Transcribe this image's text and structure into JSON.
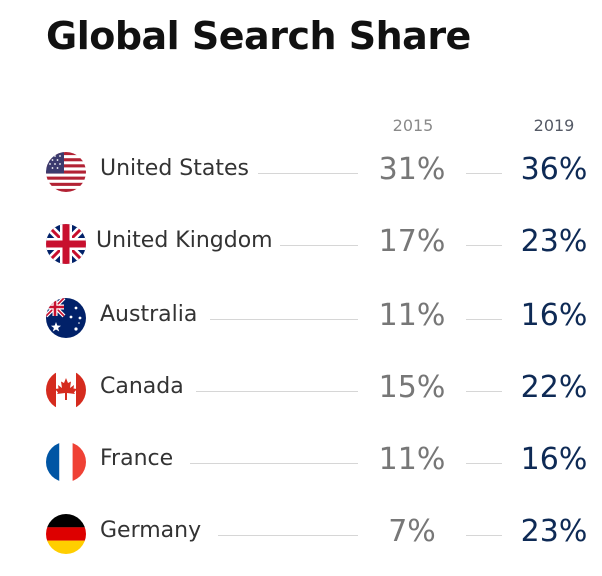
{
  "chart_data": {
    "type": "table",
    "title": "Global Search Share",
    "columns": [
      "2015",
      "2019"
    ],
    "rows": [
      {
        "country": "United States",
        "flag": "us-flag-icon",
        "v2015": "31%",
        "v2019": "36%"
      },
      {
        "country": "United Kingdom",
        "flag": "uk-flag-icon",
        "v2015": "17%",
        "v2019": "23%"
      },
      {
        "country": "Australia",
        "flag": "australia-flag-icon",
        "v2015": "11%",
        "v2019": "16%"
      },
      {
        "country": "Canada",
        "flag": "canada-flag-icon",
        "v2015": "15%",
        "v2019": "22%"
      },
      {
        "country": "France",
        "flag": "france-flag-icon",
        "v2015": "11%",
        "v2019": "16%"
      },
      {
        "country": "Germany",
        "flag": "germany-flag-icon",
        "v2015": "7%",
        "v2019": "23%"
      }
    ],
    "colors": {
      "title": "#111111",
      "value_2015": "#777777",
      "value_2019": "#0e2a55",
      "leader_line": "#d6d6d6"
    }
  }
}
